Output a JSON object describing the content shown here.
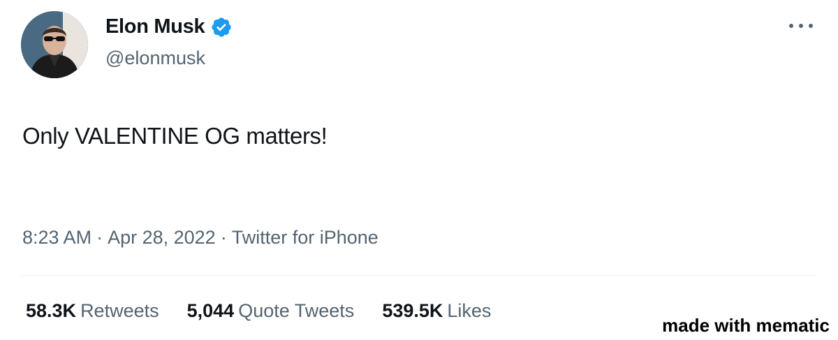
{
  "author": {
    "display_name": "Elon Musk",
    "handle": "@elonmusk",
    "avatar_icon": "profile-photo",
    "verified_icon": "verified-badge-icon",
    "verified_color": "#1d9bf0"
  },
  "menu": {
    "icon": "more-horizontal-icon"
  },
  "tweet": {
    "text": "Only VALENTINE OG matters!",
    "time": "8:23 AM",
    "separator": "·",
    "date": "Apr 28, 2022",
    "source": "Twitter for iPhone"
  },
  "stats": {
    "retweets_count": "58.3K",
    "retweets_label": "Retweets",
    "quotes_count": "5,044",
    "quotes_label": "Quote Tweets",
    "likes_count": "539.5K",
    "likes_label": "Likes"
  },
  "watermark": "made with mematic",
  "colors": {
    "text_primary": "#0f1419",
    "text_secondary": "#536471",
    "divider": "#eff3f4"
  }
}
